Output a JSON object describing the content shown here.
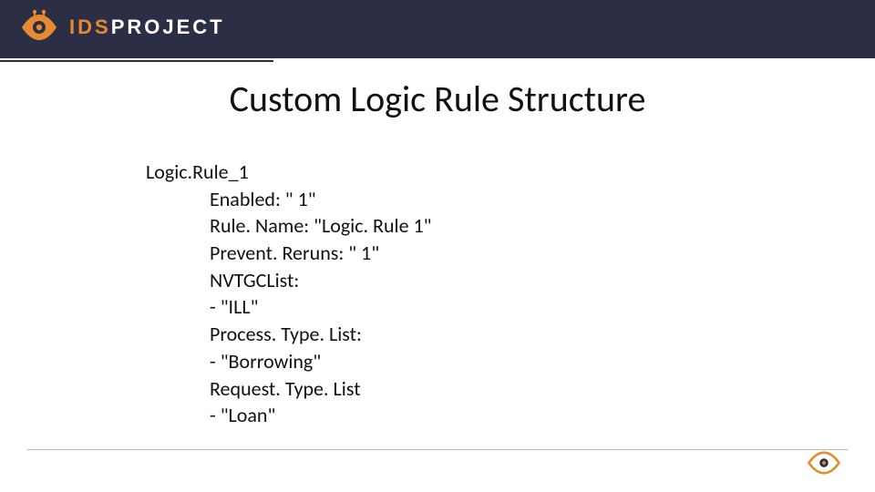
{
  "brand": {
    "ids": "IDS",
    "project": "PROJECT",
    "accent": "#e58a2e"
  },
  "slide": {
    "title": "Custom Logic Rule Structure"
  },
  "rule": {
    "header": "Logic.Rule_1",
    "lines": [
      "Enabled: \" 1\"",
      "Rule. Name: \"Logic. Rule 1\"",
      "Prevent. Reruns: \" 1\"",
      "NVTGCList:",
      "- \"ILL\"",
      "Process. Type. List:",
      "- \"Borrowing\"",
      "Request. Type. List",
      "- \"Loan\""
    ]
  }
}
